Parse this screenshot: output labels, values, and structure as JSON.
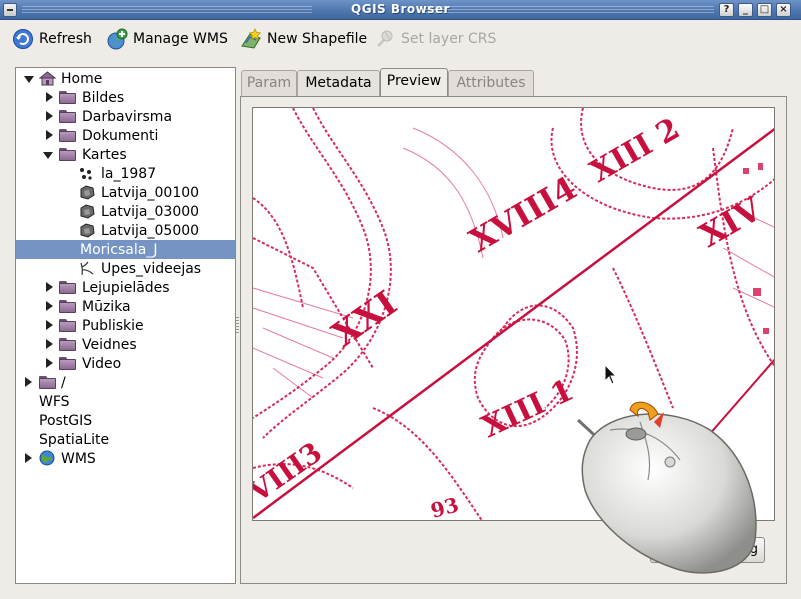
{
  "window": {
    "title": "QGIS Browser"
  },
  "window_controls": {
    "help": "?",
    "minimize": "_",
    "maximize": "□",
    "close": "×"
  },
  "toolbar": {
    "refresh_label": "Refresh",
    "manage_wms_label": "Manage WMS",
    "new_shapefile_label": "New Shapefile",
    "set_layer_crs_label": "Set layer CRS"
  },
  "tree": {
    "items": [
      {
        "label": "Home",
        "icon": "home-icon"
      },
      {
        "label": "Bildes",
        "icon": "folder-icon"
      },
      {
        "label": "Darbavirsma",
        "icon": "folder-icon"
      },
      {
        "label": "Dokumenti",
        "icon": "folder-icon"
      },
      {
        "label": "Kartes",
        "icon": "folder-icon"
      },
      {
        "label": "la_1987",
        "icon": "point-layer-icon"
      },
      {
        "label": "Latvija_00100",
        "icon": "polygon-layer-icon"
      },
      {
        "label": "Latvija_03000",
        "icon": "polygon-layer-icon"
      },
      {
        "label": "Latvija_05000",
        "icon": "polygon-layer-icon"
      },
      {
        "label": "Moricsala_J",
        "icon": "raster-layer-icon",
        "selected": true
      },
      {
        "label": "Upes_videejas",
        "icon": "line-layer-icon"
      },
      {
        "label": "Lejupielādes",
        "icon": "folder-icon"
      },
      {
        "label": "Mūzika",
        "icon": "folder-icon"
      },
      {
        "label": "Publiskie",
        "icon": "folder-icon"
      },
      {
        "label": "Veidnes",
        "icon": "folder-icon"
      },
      {
        "label": "Video",
        "icon": "folder-icon"
      },
      {
        "label": "/",
        "icon": "folder-icon"
      },
      {
        "label": "WFS",
        "icon": ""
      },
      {
        "label": "PostGIS",
        "icon": ""
      },
      {
        "label": "SpatiaLite",
        "icon": ""
      },
      {
        "label": "WMS",
        "icon": "globe-icon"
      }
    ]
  },
  "tabs": [
    {
      "label": "Param",
      "state": "disabled"
    },
    {
      "label": "Metadata",
      "state": "normal"
    },
    {
      "label": "Preview",
      "state": "active"
    },
    {
      "label": "Attributes",
      "state": "disabled"
    }
  ],
  "preview": {
    "map_labels": [
      "XXI",
      "XVIII4",
      "XIII 2",
      "XIII 1",
      "XIV",
      "VIII3",
      "93"
    ],
    "map_color": "#d4134a"
  },
  "panel_button": {
    "label": "g"
  },
  "colors": {
    "titlebar": "#4f77b0",
    "selection": "#7594c4",
    "background": "#efebe7"
  }
}
